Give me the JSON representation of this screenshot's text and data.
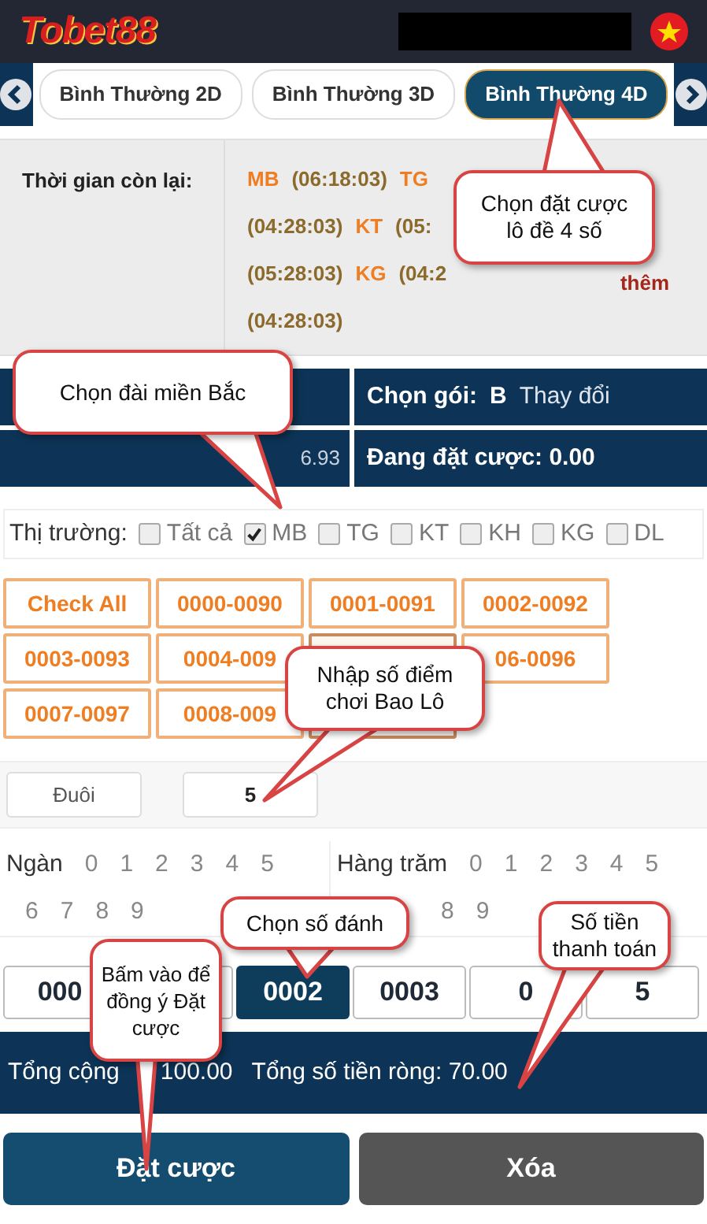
{
  "header": {
    "logo": "Tobet88"
  },
  "tabs": [
    {
      "label": "Bình Thường 2D",
      "selected": false
    },
    {
      "label": "Bình Thường 3D",
      "selected": false
    },
    {
      "label": "Bình Thường 4D",
      "selected": true
    }
  ],
  "time_left": {
    "label": "Thời gian còn lại:",
    "lines": [
      [
        {
          "kind": "code",
          "text": "MB"
        },
        {
          "kind": "time",
          "text": "(06:18:03)"
        },
        {
          "kind": "code",
          "text": "TG"
        }
      ],
      [
        {
          "kind": "time",
          "text": "(04:28:03)"
        },
        {
          "kind": "code",
          "text": "KT"
        },
        {
          "kind": "time",
          "text": "(05:"
        }
      ],
      [
        {
          "kind": "time",
          "text": "(05:28:03)"
        },
        {
          "kind": "code",
          "text": "KG"
        },
        {
          "kind": "time",
          "text": "(04:2"
        },
        {
          "kind": "more",
          "text": "thêm"
        }
      ],
      [
        {
          "kind": "time",
          "text": "(04:28:03)"
        }
      ]
    ]
  },
  "account": {
    "balance": "6.93",
    "package_label": "Chọn gói:",
    "package": "B",
    "change": "Thay đổi",
    "betting": "Đang đặt cược: 0.00"
  },
  "markets": {
    "label": "Thị trường:",
    "items": [
      {
        "label": "Tất cả",
        "checked": false
      },
      {
        "label": "MB",
        "checked": true
      },
      {
        "label": "TG",
        "checked": false
      },
      {
        "label": "KT",
        "checked": false
      },
      {
        "label": "KH",
        "checked": false
      },
      {
        "label": "KG",
        "checked": false
      },
      {
        "label": "DL",
        "checked": false
      }
    ]
  },
  "ranges": [
    {
      "kind": "range",
      "label": "Check All"
    },
    {
      "kind": "range",
      "label": "0000-0090"
    },
    {
      "kind": "range",
      "label": "0001-0091"
    },
    {
      "kind": "range",
      "label": "0002-0092"
    },
    {
      "kind": "range",
      "label": "0003-0093"
    },
    {
      "kind": "range",
      "label": "0004-009"
    },
    {
      "kind": "blank"
    },
    {
      "kind": "range",
      "label": "06-0096"
    },
    {
      "kind": "range",
      "label": "0007-0097"
    },
    {
      "kind": "range",
      "label": "0008-009"
    },
    {
      "kind": "blank"
    }
  ],
  "tail": {
    "button": "Đuôi",
    "value": "5"
  },
  "digits": [
    {
      "label": "Ngàn",
      "rows": [
        [
          "0",
          "1",
          "2",
          "3",
          "4",
          "5"
        ],
        [
          "6",
          "7",
          "8",
          "9"
        ]
      ]
    },
    {
      "label": "Hàng trăm",
      "rows": [
        [
          "0",
          "1",
          "2",
          "3",
          "4",
          "5"
        ],
        [
          "8",
          "9"
        ]
      ]
    }
  ],
  "numbers": [
    {
      "label": "000",
      "selected": false
    },
    {
      "selected": false
    },
    {
      "label": "0002",
      "selected": true
    },
    {
      "label": "0003",
      "selected": false
    },
    {
      "label": "0",
      "selected": false
    },
    {
      "label": "5",
      "selected": false
    }
  ],
  "totals": {
    "total": "Tổng cộng",
    "total_value": "100.00",
    "net": "Tổng số tiền ròng: 70.00"
  },
  "buttons": {
    "bet": "Đặt cược",
    "clear": "Xóa"
  },
  "callouts": [
    "Chọn đặt cược lô đề 4 số",
    "Chọn đài miền Bắc",
    "Nhập số điểm chơi Bao Lô",
    "Chọn số đánh",
    "Bấm vào để đồng ý Đặt cược",
    "Số tiền thanh toán"
  ]
}
